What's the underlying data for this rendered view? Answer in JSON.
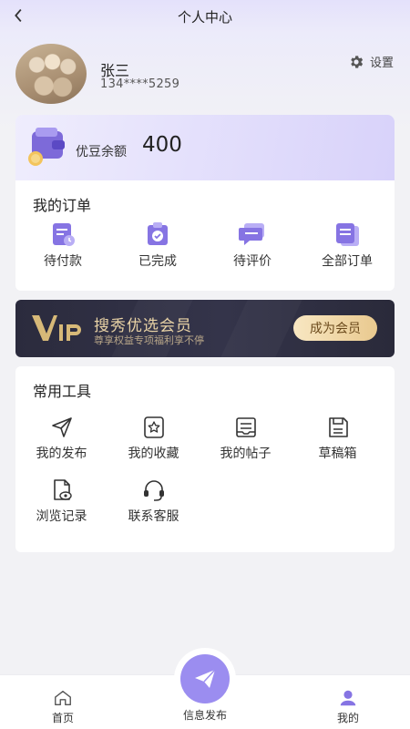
{
  "header": {
    "title": "个人中心"
  },
  "profile": {
    "name": "张三",
    "phone": "134****5259",
    "settings_label": "设置"
  },
  "balance": {
    "label": "优豆余额",
    "value": "400"
  },
  "orders": {
    "title": "我的订单",
    "items": [
      {
        "label": "待付款",
        "icon": "pending-payment-icon"
      },
      {
        "label": "已完成",
        "icon": "completed-icon"
      },
      {
        "label": "待评价",
        "icon": "pending-review-icon"
      },
      {
        "label": "全部订单",
        "icon": "all-orders-icon"
      }
    ]
  },
  "vip": {
    "title": "搜秀优选会员",
    "subtitle": "尊享权益专项福利享不停",
    "button": "成为会员"
  },
  "tools": {
    "title": "常用工具",
    "items": [
      {
        "label": "我的发布",
        "icon": "send-icon"
      },
      {
        "label": "我的收藏",
        "icon": "favorite-icon"
      },
      {
        "label": "我的帖子",
        "icon": "posts-icon"
      },
      {
        "label": "草稿箱",
        "icon": "draft-icon"
      },
      {
        "label": "浏览记录",
        "icon": "history-icon"
      },
      {
        "label": "联系客服",
        "icon": "headset-icon"
      }
    ]
  },
  "tabbar": {
    "home": "首页",
    "publish": "信息发布",
    "me": "我的"
  },
  "colors": {
    "accent": "#9b8df0",
    "vip_gold": "#e9d3a6",
    "vip_bg": "#2b2b3d"
  }
}
